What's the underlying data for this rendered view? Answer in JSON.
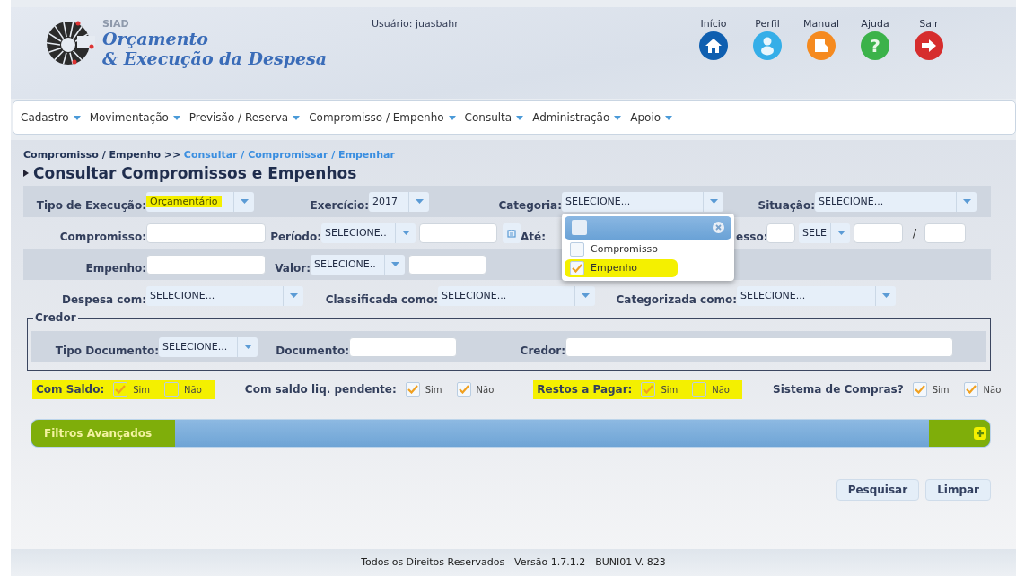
{
  "header": {
    "system_tag": "SIAD",
    "title_line_1": "Orçamento",
    "title_line_2": "& Execução da Despesa",
    "user": "Usuário: juasbahr",
    "nav": [
      {
        "label": "Início",
        "kind": "home"
      },
      {
        "label": "Perfil",
        "kind": "profile"
      },
      {
        "label": "Manual",
        "kind": "manual"
      },
      {
        "label": "Ajuda",
        "kind": "help",
        "glyph": "?"
      },
      {
        "label": "Sair",
        "kind": "exit"
      }
    ]
  },
  "menu": [
    "Cadastro",
    "Movimentação",
    "Previsão / Reserva",
    "Compromisso / Empenho",
    "Consulta",
    "Administração",
    "Apoio"
  ],
  "breadcrumb": {
    "parent": "Compromisso / Empenho >>",
    "current": "Consultar / Compromissar / Empenhar"
  },
  "page_title": "Consultar Compromissos e Empenhos",
  "form_rows": [
    {
      "striped": true,
      "fields": [
        {
          "label": "Tipo de Execução:",
          "controls": [
            {
              "kind": "select",
              "value": "Orçamentário",
              "highlighted": true
            }
          ]
        },
        {
          "label": "Exercício:",
          "controls": [
            {
              "kind": "select",
              "value": "2017"
            }
          ]
        },
        {
          "label": "Categoria:",
          "controls": [
            {
              "kind": "select",
              "value": "SELECIONE...",
              "dropdown": {
                "open": true,
                "select_all_checked": false,
                "options": [
                  {
                    "label": "Compromisso",
                    "checked": false,
                    "highlighted": false
                  },
                  {
                    "label": "Empenho",
                    "checked": true,
                    "highlighted": true
                  }
                ]
              }
            }
          ]
        },
        {
          "label": "Situação:",
          "controls": [
            {
              "kind": "select",
              "value": "SELECIONE..."
            }
          ]
        }
      ]
    },
    {
      "striped": false,
      "fields": [
        {
          "label": "Compromisso:",
          "controls": [
            {
              "kind": "text"
            }
          ]
        },
        {
          "label": "Período:",
          "controls": [
            {
              "kind": "select",
              "value": "SELECIONE.."
            },
            {
              "kind": "text"
            },
            {
              "kind": "calendar"
            }
          ]
        },
        {
          "label": "Até:"
        },
        {
          "label": "esso:",
          "controls": [
            {
              "kind": "text"
            },
            {
              "kind": "select",
              "value": "SELE"
            },
            {
              "kind": "text"
            },
            {
              "kind": "separator",
              "value": "/"
            },
            {
              "kind": "text"
            }
          ]
        }
      ]
    },
    {
      "striped": true,
      "fields": [
        {
          "label": "Empenho:",
          "controls": [
            {
              "kind": "text"
            }
          ]
        },
        {
          "label": "Valor:",
          "controls": [
            {
              "kind": "select",
              "value": "SELECIONE.."
            },
            {
              "kind": "text"
            }
          ]
        }
      ]
    },
    {
      "striped": false,
      "fields": [
        {
          "label": "Despesa com:",
          "controls": [
            {
              "kind": "select",
              "value": "SELECIONE..."
            }
          ]
        },
        {
          "label": "Classificada como:",
          "controls": [
            {
              "kind": "select",
              "value": "SELECIONE..."
            }
          ]
        },
        {
          "label": "Categorizada como:",
          "controls": [
            {
              "kind": "select",
              "value": "SELECIONE..."
            }
          ]
        }
      ]
    }
  ],
  "credor": {
    "legend": "Credor",
    "fields": [
      {
        "label": "Tipo Documento:",
        "controls": [
          {
            "kind": "select",
            "value": "SELECIONE..."
          }
        ]
      },
      {
        "label": "Documento:",
        "controls": [
          {
            "kind": "text"
          }
        ]
      },
      {
        "label": "Credor:",
        "controls": [
          {
            "kind": "text"
          }
        ]
      }
    ]
  },
  "checkbox_groups": [
    {
      "label": "Com Saldo:",
      "highlighted": true,
      "options": [
        {
          "label": "Sim",
          "checked": true
        },
        {
          "label": "Não",
          "checked": false
        }
      ]
    },
    {
      "label": "Com saldo liq. pendente:",
      "highlighted": false,
      "options": [
        {
          "label": "Sim",
          "checked": true
        },
        {
          "label": "Não",
          "checked": true
        }
      ]
    },
    {
      "label": "Restos a Pagar:",
      "highlighted": true,
      "options": [
        {
          "label": "Sim",
          "checked": true
        },
        {
          "label": "Não",
          "checked": false
        }
      ]
    },
    {
      "label": "Sistema de Compras?",
      "highlighted": false,
      "options": [
        {
          "label": "Sim",
          "checked": true
        },
        {
          "label": "Não",
          "checked": true
        }
      ]
    }
  ],
  "advanced_filters": {
    "title": "Filtros Avançados",
    "expanded": false,
    "highlighted": true
  },
  "buttons": [
    "Pesquisar",
    "Limpar"
  ],
  "footer": "Todos os Direitos Reservados - Versão 1.7.1.2 - BUNI01 V. 823"
}
